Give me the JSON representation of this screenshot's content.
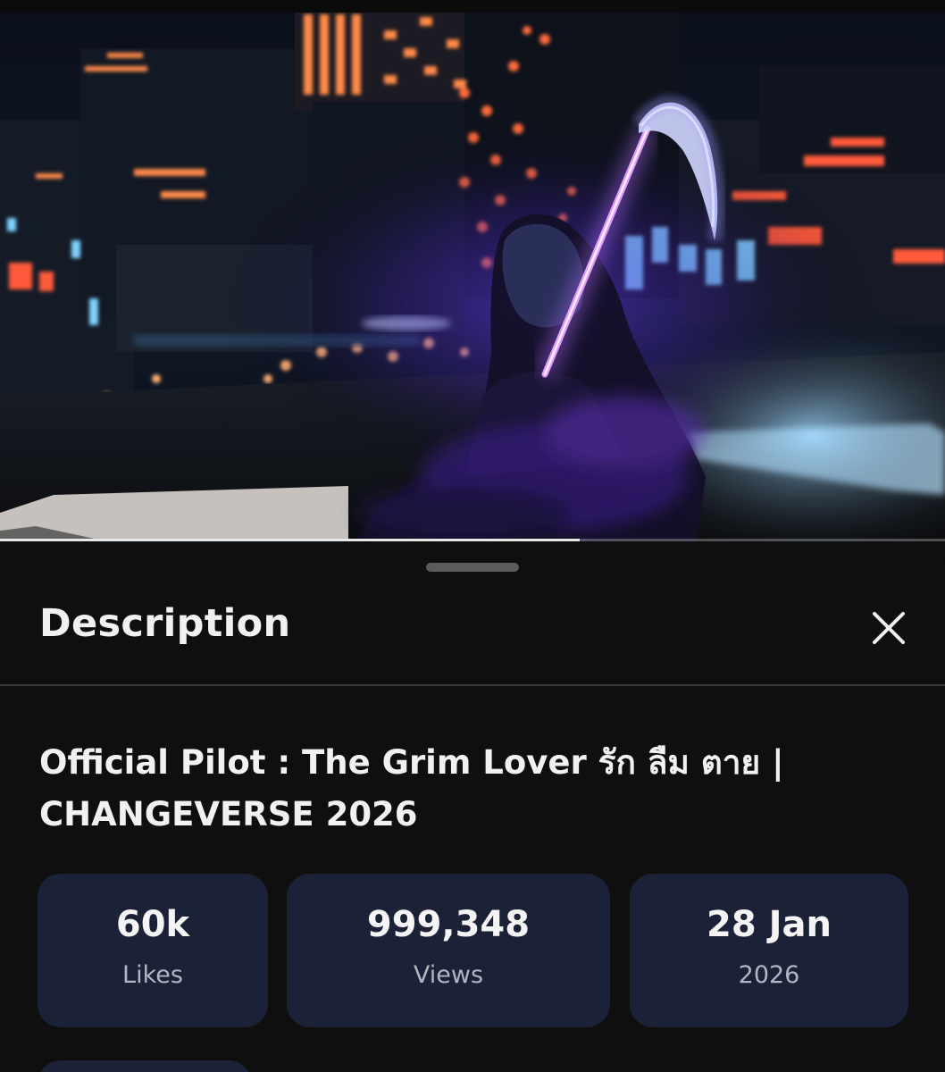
{
  "video": {
    "playback_progress": 0.613
  },
  "description_panel": {
    "title": "Description",
    "close_icon": "close-icon",
    "video_title": "Official Pilot : The Grim Lover รัก ลืม ตาย | CHANGEVERSE 2026",
    "stats": [
      {
        "value": "60k",
        "label": "Likes"
      },
      {
        "value": "999,348",
        "label": "Views"
      },
      {
        "value": "28 Jan",
        "label": "2026"
      }
    ]
  },
  "colors": {
    "background": "#0f0f0f",
    "card": "#1b2136",
    "text_primary": "#f1f1f1",
    "text_secondary": "#b3b6c0",
    "scythe_glow": "#b070ff"
  }
}
